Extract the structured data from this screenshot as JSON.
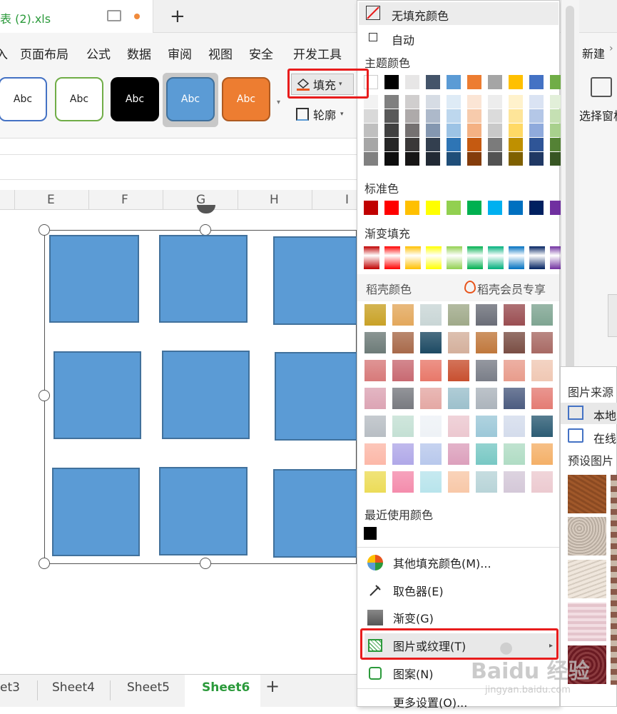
{
  "titlebar": {
    "doc_title": "表 (2).xls",
    "new_tab": "+"
  },
  "menu": {
    "items": [
      "入",
      "页面布局",
      "公式",
      "数据",
      "审阅",
      "视图",
      "安全",
      "开发工具"
    ],
    "right_item": "新建"
  },
  "ribbon": {
    "style_label": "Abc",
    "fill_label": "填充",
    "outline_label": "轮廓",
    "select_pane_label": "选择窗格"
  },
  "columns": [
    "E",
    "F",
    "G",
    "H",
    "I"
  ],
  "sheet_tabs": [
    "et3",
    "Sheet4",
    "Sheet5",
    "Sheet6",
    "+"
  ],
  "active_sheet": "Sheet6",
  "color_menu": {
    "no_fill": "无填充颜色",
    "auto": "自动",
    "theme_label": "主题颜色",
    "theme_top": [
      "#ffffff",
      "#000000",
      "#e7e6e6",
      "#44546a",
      "#5b9bd5",
      "#ed7d31",
      "#a5a5a5",
      "#ffc000",
      "#4472c4",
      "#70ad47"
    ],
    "theme_shades": [
      [
        "#f2f2f2",
        "#d9d9d9",
        "#bfbfbf",
        "#a6a6a6",
        "#808080"
      ],
      [
        "#808080",
        "#595959",
        "#404040",
        "#262626",
        "#0d0d0d"
      ],
      [
        "#d0cece",
        "#aeaaaa",
        "#757171",
        "#3a3838",
        "#171616"
      ],
      [
        "#d6dce4",
        "#adb9ca",
        "#8497b0",
        "#333f4f",
        "#222a35"
      ],
      [
        "#deebf6",
        "#bdd7ee",
        "#9cc3e5",
        "#2e75b5",
        "#1f4e79"
      ],
      [
        "#fbe5d5",
        "#f7cbac",
        "#f4b183",
        "#c55a11",
        "#843c0b"
      ],
      [
        "#ededed",
        "#dbdbdb",
        "#c9c9c9",
        "#7b7b7b",
        "#525252"
      ],
      [
        "#fff2cc",
        "#fee599",
        "#ffd965",
        "#bf9000",
        "#7f6000"
      ],
      [
        "#dae3f3",
        "#b4c7e7",
        "#8faadc",
        "#2f5597",
        "#203864"
      ],
      [
        "#e2efd9",
        "#c5e0b3",
        "#a8d08d",
        "#548235",
        "#375623"
      ]
    ],
    "standard_label": "标准色",
    "standard": [
      "#c00000",
      "#ff0000",
      "#ffc000",
      "#ffff00",
      "#92d050",
      "#00b050",
      "#00b0f0",
      "#0070c0",
      "#002060",
      "#7030a0"
    ],
    "gradient_label": "渐变填充",
    "gradient": [
      "#c00000",
      "#ff0000",
      "#ffc000",
      "#ffff00",
      "#92d050",
      "#00b050",
      "#00b07c",
      "#0070c0",
      "#002060",
      "#7030a0"
    ],
    "docer_label": "稻壳颜色",
    "docer_member": "稻壳会员专享",
    "docer_rows": [
      [
        "#c9a227",
        "#e3a85c",
        "#c9d6d6",
        "#a0aa8a",
        "#6b6e78",
        "#9a4e52",
        "#7fa592"
      ],
      [
        "#6d7b78",
        "#a86a4a",
        "#1d4a63",
        "#d4b09c",
        "#c0783c",
        "#7a4e44",
        "#a86a64"
      ],
      [
        "#d77a7a",
        "#c86a72",
        "#e8786a",
        "#c85030",
        "#7a7e88",
        "#e89c8c",
        "#f0c8b4"
      ],
      [
        "#dca4b4",
        "#787a80",
        "#e4a8a4",
        "#9cc0cc",
        "#acb4bc",
        "#4c5c80",
        "#e47c74"
      ],
      [
        "#b8bec4",
        "#c4e0d4",
        "#eef2f6",
        "#ecc8d0",
        "#9cc8d8",
        "#d4dcec",
        "#2c5c74"
      ],
      [
        "#fcb8a8",
        "#b0a8e8",
        "#b8c8ec",
        "#dca0bc",
        "#78c8c4",
        "#b0dcc4",
        "#f4b068"
      ],
      [
        "#ecdc58",
        "#f48cac",
        "#b8e4ec",
        "#f8c8a8",
        "#b8d4d8",
        "#d4c8d8",
        "#eccad0"
      ]
    ],
    "recent_label": "最近使用颜色",
    "recent": [
      "#000000"
    ],
    "more_colors": "其他填充颜色(M)...",
    "eyedropper": "取色器(E)",
    "gradient_item": "渐变(G)",
    "picture_texture": "图片或纹理(T)",
    "pattern": "图案(N)",
    "more_settings": "更多设置(O)..."
  },
  "submenu": {
    "source_label": "图片来源",
    "local": "本地",
    "online": "在线",
    "preset_label": "预设图片"
  },
  "watermark": {
    "brand": "Baidu 经验",
    "url": "jingyan.baidu.com"
  },
  "colors": {
    "accent_green": "#2b9a3b",
    "shape_fill": "#5b9bd5",
    "shape_border": "#41719c",
    "highlight": "#e81c1c"
  }
}
